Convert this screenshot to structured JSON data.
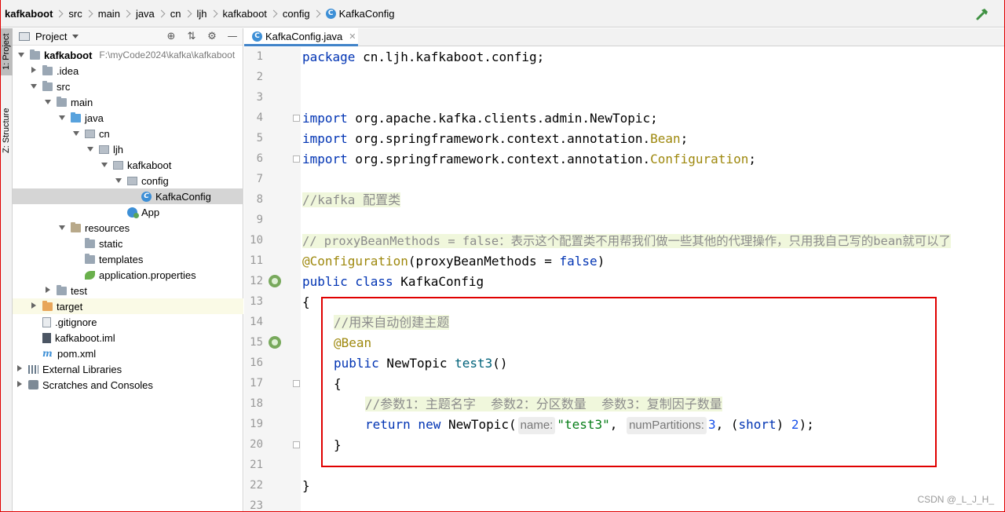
{
  "breadcrumbs": [
    "kafkaboot",
    "src",
    "main",
    "java",
    "cn",
    "ljh",
    "kafkaboot",
    "config",
    "KafkaConfig"
  ],
  "side_tabs": {
    "project": "1: Project",
    "structure": "Z: Structure"
  },
  "project_panel": {
    "title": "Project",
    "tree": [
      {
        "label": "kafkaboot",
        "path": "F:\\myCode2024\\kafka\\kafkaboot",
        "icon": "module-folder-icon"
      },
      {
        "label": ".idea",
        "icon": "folder-icon"
      },
      {
        "label": "src",
        "icon": "folder-icon"
      },
      {
        "label": "main",
        "icon": "folder-icon"
      },
      {
        "label": "java",
        "icon": "source-folder-icon"
      },
      {
        "label": "cn",
        "icon": "package-icon"
      },
      {
        "label": "ljh",
        "icon": "package-icon"
      },
      {
        "label": "kafkaboot",
        "icon": "package-icon"
      },
      {
        "label": "config",
        "icon": "package-icon"
      },
      {
        "label": "KafkaConfig",
        "icon": "class-icon"
      },
      {
        "label": "App",
        "icon": "spring-boot-class-icon"
      },
      {
        "label": "resources",
        "icon": "resources-folder-icon"
      },
      {
        "label": "static",
        "icon": "folder-icon"
      },
      {
        "label": "templates",
        "icon": "folder-icon"
      },
      {
        "label": "application.properties",
        "icon": "spring-properties-icon"
      },
      {
        "label": "test",
        "icon": "folder-icon"
      },
      {
        "label": "target",
        "icon": "excluded-folder-icon"
      },
      {
        "label": ".gitignore",
        "icon": "file-icon"
      },
      {
        "label": "kafkaboot.iml",
        "icon": "iml-file-icon"
      },
      {
        "label": "pom.xml",
        "icon": "maven-icon"
      },
      {
        "label": "External Libraries",
        "icon": "libraries-icon"
      },
      {
        "label": "Scratches and Consoles",
        "icon": "scratches-icon"
      }
    ]
  },
  "editor": {
    "tab_label": "KafkaConfig.java",
    "line_numbers": [
      "1",
      "2",
      "3",
      "4",
      "5",
      "6",
      "7",
      "8",
      "9",
      "10",
      "11",
      "12",
      "13",
      "14",
      "15",
      "16",
      "17",
      "18",
      "19",
      "20",
      "21",
      "22",
      "23"
    ],
    "code": {
      "l1_kw": "package",
      "l1_rest": " cn.ljh.kafkaboot.config;",
      "l4_kw": "import",
      "l4_rest": " org.apache.kafka.clients.admin.NewTopic;",
      "l5_kw": "import",
      "l5_pkg": " org.springframework.context.annotation.",
      "l5_cls": "Bean",
      "l5_end": ";",
      "l6_kw": "import",
      "l6_pkg": " org.springframework.context.annotation.",
      "l6_cls": "Configuration",
      "l6_end": ";",
      "l8_comment": "//kafka 配置类",
      "l10_comment": "// proxyBeanMethods = false：表示这个配置类不用帮我们做一些其他的代理操作，只用我自己写的bean就可以了",
      "l11_ann": "@Configuration",
      "l11_open": "(proxyBeanMethods = ",
      "l11_val": "false",
      "l11_close": ")",
      "l12_kw": "public class",
      "l12_name": " KafkaConfig",
      "l13": "{",
      "l14_comment": "//用来自动创建主题",
      "l15_ann": "@Bean",
      "l16_kw": "public",
      "l16_type": " NewTopic ",
      "l16_fn": "test3",
      "l16_end": "()",
      "l17": "{",
      "l18_comment": "//参数1：主题名字  参数2：分区数量  参数3：复制因子数量",
      "l19_kw1": "return",
      "l19_kw2": " new",
      "l19_call": " NewTopic(",
      "l19_hint1": "name:",
      "l19_str": "\"test3\"",
      "l19_comma1": ", ",
      "l19_hint2": "numPartitions:",
      "l19_num1": "3",
      "l19_comma2": ", (",
      "l19_short": "short",
      "l19_paren": ") ",
      "l19_num2": "2",
      "l19_end": ");",
      "l20": "}",
      "l22": "}"
    }
  },
  "watermark": "CSDN @_L_J_H_"
}
